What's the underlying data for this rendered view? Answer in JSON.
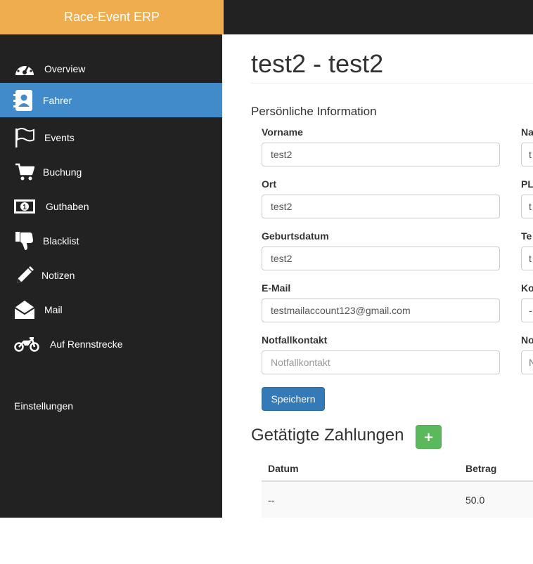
{
  "app": {
    "title": "Race-Event ERP"
  },
  "sidebar": {
    "items": [
      {
        "label": "Overview",
        "icon": "dashboard-icon",
        "active": false
      },
      {
        "label": "Fahrer",
        "icon": "contact-book-icon",
        "active": true
      },
      {
        "label": "Events",
        "icon": "flag-icon",
        "active": false
      },
      {
        "label": "Buchung",
        "icon": "shopping-cart-icon",
        "active": false
      },
      {
        "label": "Guthaben",
        "icon": "banknote-icon",
        "active": false
      },
      {
        "label": "Blacklist",
        "icon": "thumbs-down-icon",
        "active": false
      },
      {
        "label": "Notizen",
        "icon": "pencil-icon",
        "active": false
      },
      {
        "label": "Mail",
        "icon": "envelope-open-icon",
        "active": false
      },
      {
        "label": "Auf Rennstrecke",
        "icon": "motorcycle-icon",
        "active": false
      }
    ],
    "settings_label": "Einstellungen"
  },
  "page": {
    "title": "test2 - test2"
  },
  "form": {
    "section_title": "Persönliche Information",
    "fields": [
      {
        "label": "Vorname",
        "value": "test2",
        "placeholder": ""
      },
      {
        "label": "Ort",
        "value": "test2",
        "placeholder": ""
      },
      {
        "label": "Geburtsdatum",
        "value": "test2",
        "placeholder": ""
      },
      {
        "label": "E-Mail",
        "value": "testmailaccount123@gmail.com",
        "placeholder": ""
      },
      {
        "label": "Notfallkontakt",
        "value": "",
        "placeholder": "Notfallkontakt"
      }
    ],
    "right_fields": [
      {
        "label": "Na",
        "value": "t"
      },
      {
        "label": "PL",
        "value": "t"
      },
      {
        "label": "Te",
        "value": "t"
      },
      {
        "label": "Ko",
        "value": "-"
      },
      {
        "label": "No",
        "value": "",
        "placeholder": "N"
      }
    ],
    "save_label": "Speichern"
  },
  "payments": {
    "title": "Getätigte Zahlungen",
    "add_label": "+",
    "columns": [
      "Datum",
      "Betrag"
    ],
    "rows": [
      [
        "--",
        "50.0"
      ]
    ]
  },
  "colors": {
    "brand": "#f0ad4e",
    "sidebar": "#222222",
    "active": "#428bca",
    "primary": "#337ab7",
    "success": "#5cb85c"
  }
}
